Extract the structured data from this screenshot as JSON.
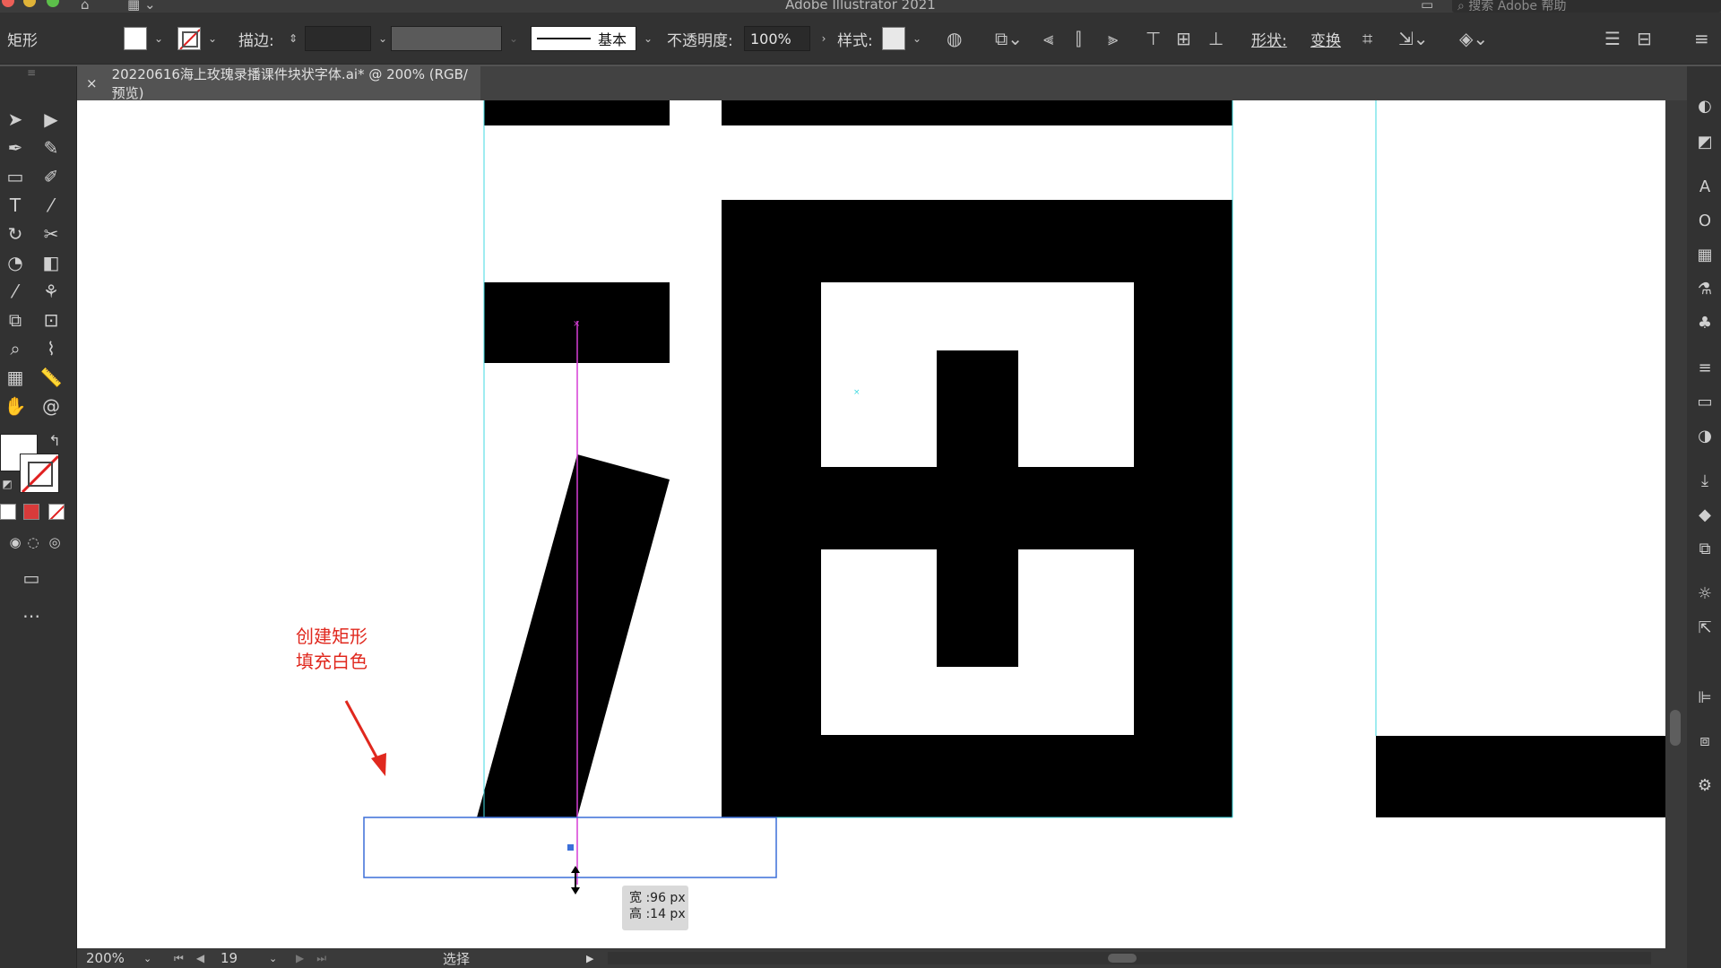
{
  "window": {
    "title": "Adobe Illustrator 2021",
    "search_placeholder": "搜索 Adobe 帮助"
  },
  "control_bar": {
    "tool_name": "矩形",
    "stroke_label": "描边:",
    "stroke_style_label": "基本",
    "opacity_label": "不透明度:",
    "opacity_value": "100%",
    "style_label": "样式:",
    "shape_label": "形状:",
    "transform_label": "变换"
  },
  "document": {
    "tab_title": "20220616海上玫瑰录播课件块状字体.ai* @ 200% (RGB/预览)"
  },
  "annotation": {
    "line1": "创建矩形",
    "line2": "填充白色"
  },
  "tooltip": {
    "width_text": "宽 :96 px",
    "height_text": "高 :14 px"
  },
  "status_bar": {
    "zoom": "200%",
    "artboard_number": "19",
    "status_text": "选择"
  },
  "colors": {
    "annotation_red": "#e0281e",
    "guide_cyan": "#3fd9e0",
    "smart_guide_magenta": "#d63fd6",
    "selection_blue": "#3b6fd9"
  }
}
